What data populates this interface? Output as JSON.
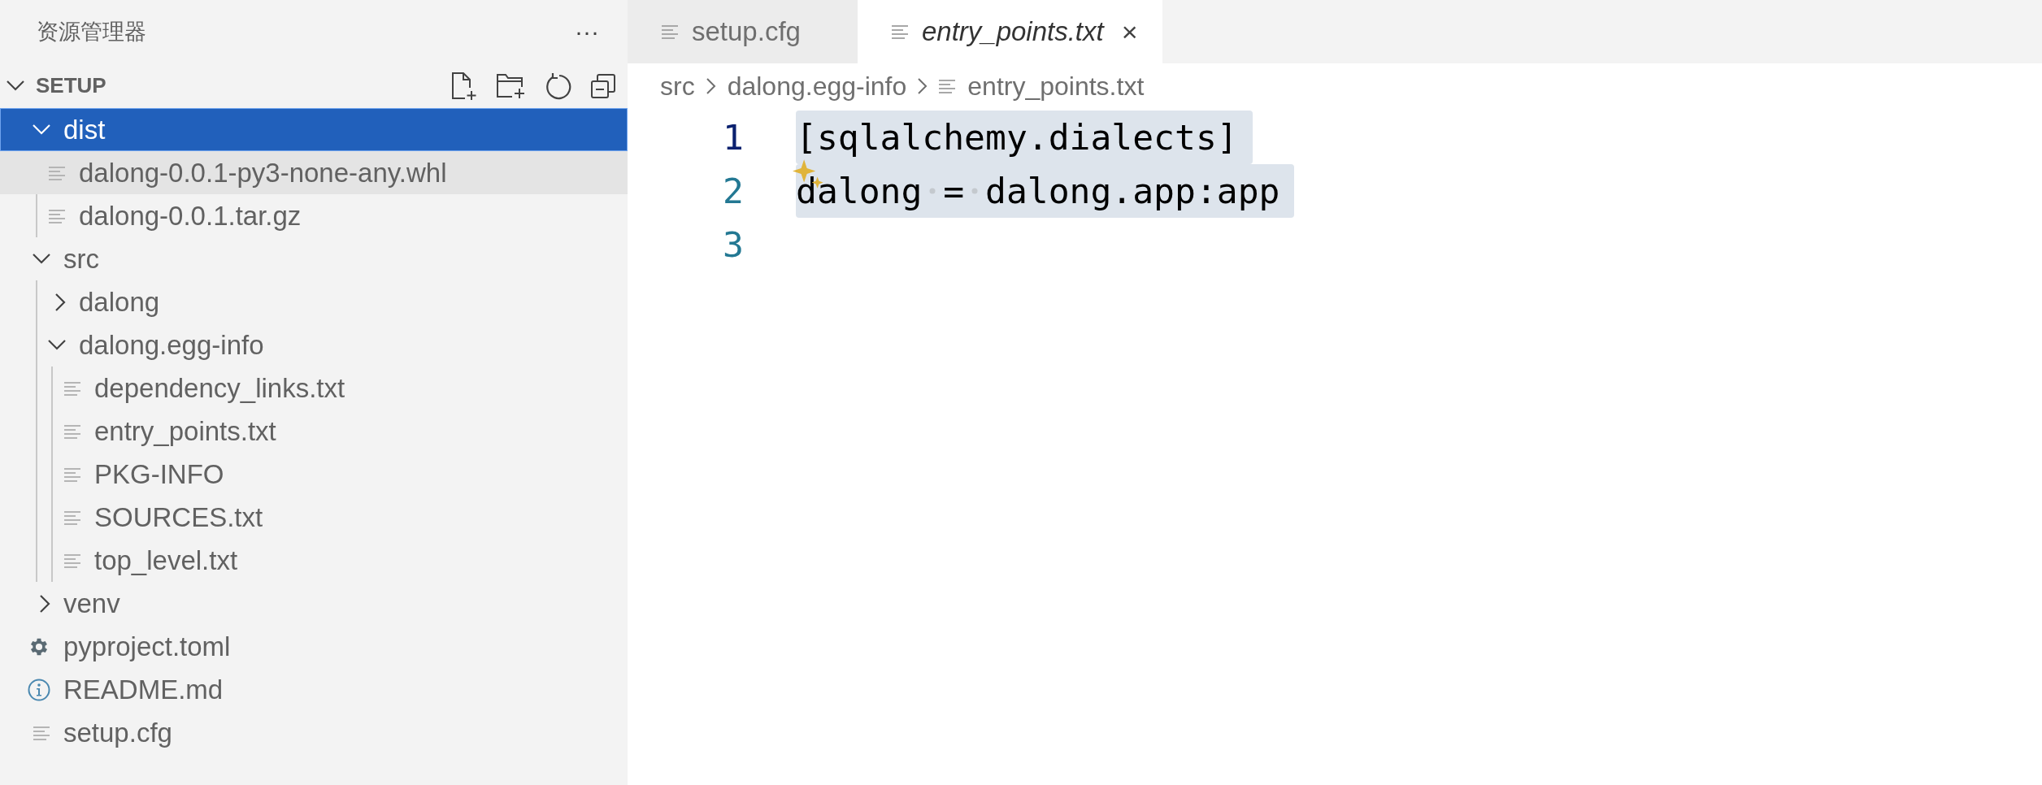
{
  "sidebar": {
    "title": "资源管理器",
    "more": "···",
    "section": {
      "label": "SETUP",
      "expanded": true
    },
    "tree": [
      {
        "kind": "folder",
        "name": "dist",
        "expanded": true,
        "selected": true,
        "hovered": false,
        "children": [
          {
            "kind": "text-file",
            "name": "dalong-0.0.1-py3-none-any.whl",
            "selected": false,
            "hovered": true
          },
          {
            "kind": "text-file",
            "name": "dalong-0.0.1.tar.gz",
            "selected": false,
            "hovered": false
          }
        ]
      },
      {
        "kind": "folder",
        "name": "src",
        "expanded": true,
        "selected": false,
        "hovered": false,
        "children": [
          {
            "kind": "folder",
            "name": "dalong",
            "expanded": false,
            "selected": false,
            "hovered": false
          },
          {
            "kind": "folder",
            "name": "dalong.egg-info",
            "expanded": true,
            "selected": false,
            "hovered": false,
            "children": [
              {
                "kind": "text-file",
                "name": "dependency_links.txt",
                "selected": false,
                "hovered": false
              },
              {
                "kind": "text-file",
                "name": "entry_points.txt",
                "selected": false,
                "hovered": false
              },
              {
                "kind": "text-file",
                "name": "PKG-INFO",
                "selected": false,
                "hovered": false
              },
              {
                "kind": "text-file",
                "name": "SOURCES.txt",
                "selected": false,
                "hovered": false
              },
              {
                "kind": "text-file",
                "name": "top_level.txt",
                "selected": false,
                "hovered": false
              }
            ]
          }
        ]
      },
      {
        "kind": "folder",
        "name": "venv",
        "expanded": false,
        "selected": false,
        "hovered": false
      },
      {
        "kind": "settings-file",
        "name": "pyproject.toml",
        "selected": false,
        "hovered": false
      },
      {
        "kind": "info-file",
        "name": "README.md",
        "selected": false,
        "hovered": false
      },
      {
        "kind": "text-file",
        "name": "setup.cfg",
        "selected": false,
        "hovered": false
      }
    ]
  },
  "tabs": [
    {
      "label": "setup.cfg",
      "selected": false
    },
    {
      "label": "entry_points.txt",
      "selected": true,
      "close": "×"
    }
  ],
  "breadcrumbs": [
    "src",
    "dalong.egg-info",
    "entry_points.txt"
  ],
  "editor": {
    "lines": [
      {
        "number": "1",
        "text": "[sqlalchemy.dialects]",
        "selected": true,
        "active": true
      },
      {
        "number": "2",
        "text": "dalong = dalong.app:app",
        "selected": true,
        "active": false,
        "sparkle": true
      },
      {
        "number": "3",
        "active": false
      }
    ]
  }
}
